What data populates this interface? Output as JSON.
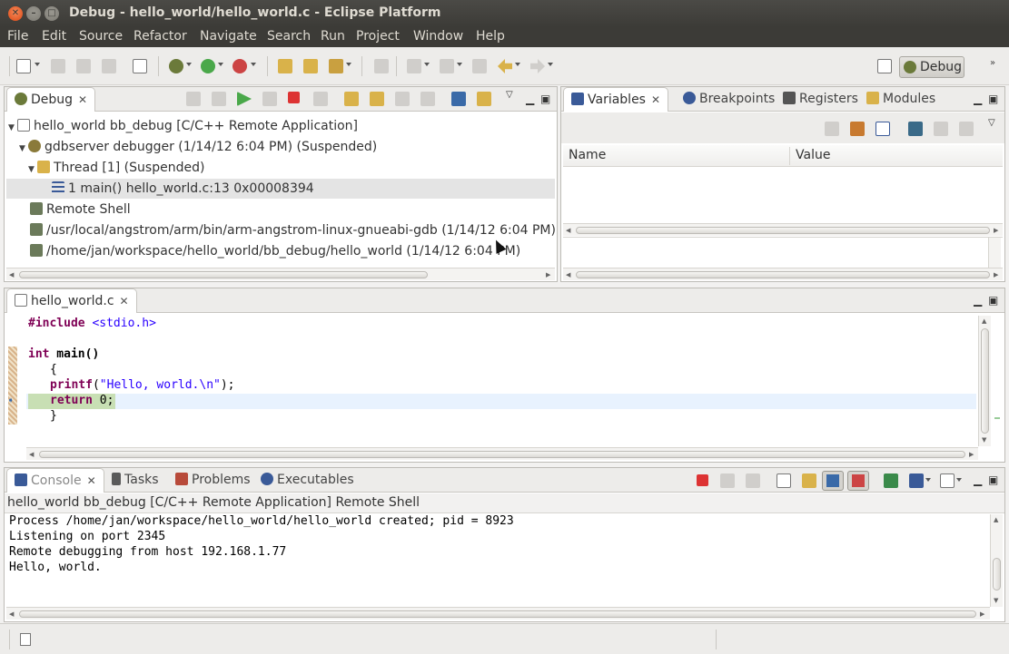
{
  "window": {
    "title": "Debug - hello_world/hello_world.c - Eclipse Platform"
  },
  "menu": [
    "File",
    "Edit",
    "Source",
    "Refactor",
    "Navigate",
    "Search",
    "Run",
    "Project",
    "Window",
    "Help"
  ],
  "perspective": {
    "label": "Debug"
  },
  "debug_view": {
    "tab": "Debug",
    "rows": [
      "hello_world bb_debug [C/C++ Remote Application]",
      "gdbserver debugger (1/14/12 6:04 PM) (Suspended)",
      "Thread [1] (Suspended)",
      "1 main() hello_world.c:13 0x00008394",
      "Remote Shell",
      "/usr/local/angstrom/arm/bin/arm-angstrom-linux-gnueabi-gdb (1/14/12 6:04 PM)",
      "/home/jan/workspace/hello_world/bb_debug/hello_world (1/14/12 6:04 PM)"
    ]
  },
  "variables_view": {
    "tabs": [
      "Variables",
      "Breakpoints",
      "Registers",
      "Modules"
    ],
    "columns": [
      "Name",
      "Value"
    ]
  },
  "editor": {
    "tab": "hello_world.c",
    "lines": {
      "include_kw": "#include",
      "include_val": " <stdio.h>",
      "int_kw": "int",
      "main_sig": " main()",
      "open_brace": "{",
      "printf_fn": "printf",
      "printf_open": "(",
      "printf_str": "\"Hello, world.\\n\"",
      "printf_close": ");",
      "return_kw": "return",
      "return_val": " 0;",
      "close_brace": "}"
    }
  },
  "console_view": {
    "tabs": [
      "Console",
      "Tasks",
      "Problems",
      "Executables"
    ],
    "header": "hello_world bb_debug [C/C++ Remote Application] Remote Shell",
    "lines": [
      "Process /home/jan/workspace/hello_world/hello_world created; pid = 8923",
      "Listening on port 2345",
      "Remote debugging from host 192.168.1.77",
      "Hello, world."
    ]
  },
  "colors": {
    "titlebar": "#3c3b37",
    "keyword": "#7f0055",
    "string": "#2a00ff",
    "current_line": "#e8f2fe",
    "current_instruction": "#c8dfb4"
  }
}
